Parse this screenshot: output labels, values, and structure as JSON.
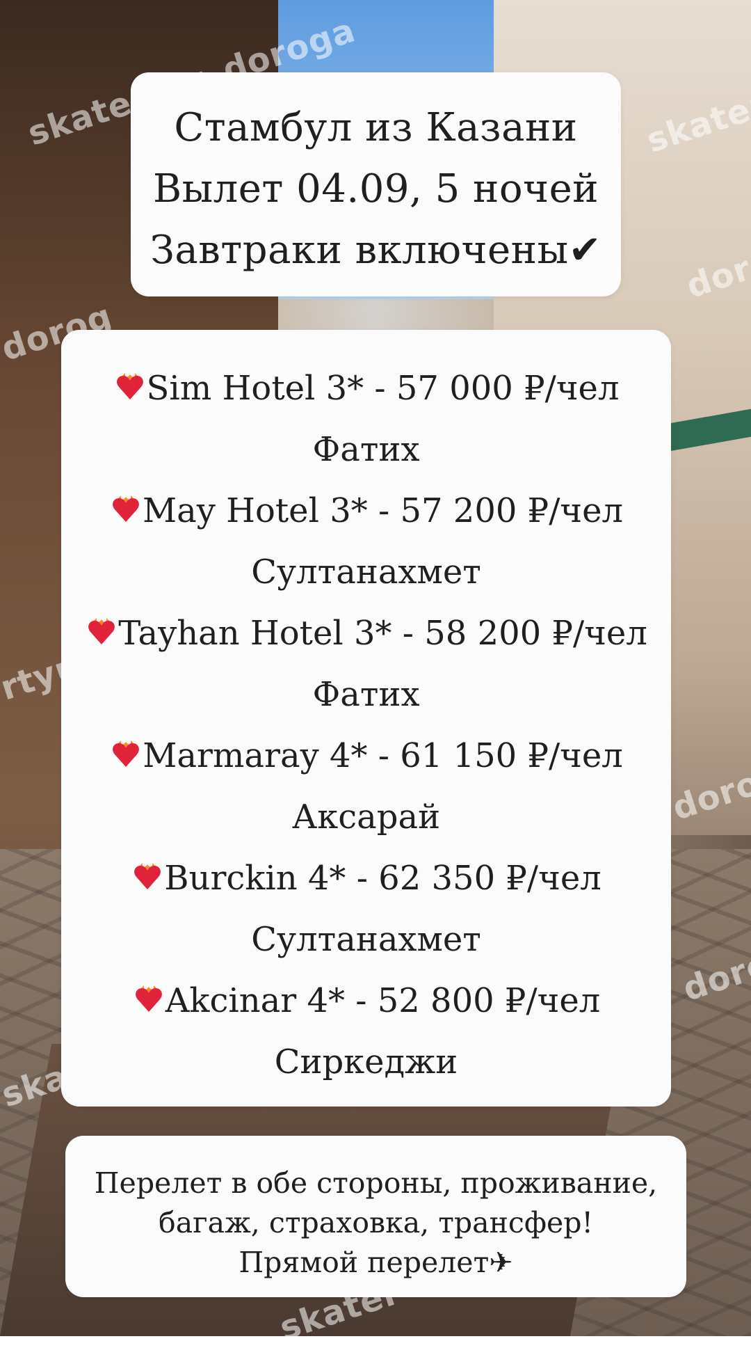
{
  "colors": {
    "card_bg": "#fbfbfb",
    "text": "#1f1f1f",
    "heart_fill": "#e0233b",
    "heart_flame": "#ff8a1a",
    "watermark": "rgba(255,255,255,0.55)"
  },
  "watermarks": [
    "skatertyu_doroga",
    "skatertyu_doroga",
    "dorog",
    "dorog",
    "rtyu",
    "dorog",
    "dorog",
    "skater",
    "skater"
  ],
  "title_card": {
    "line1": "Стамбул из Казани",
    "line2": "Вылет 04.09, 5 ночей",
    "line3": "Завтраки включены",
    "check_icon": "✔"
  },
  "hotels": [
    {
      "icon": "heart-on-fire-icon",
      "name": "Sim Hotel 3* - 57 000 ₽/чел",
      "district": "Фатих"
    },
    {
      "icon": "heart-on-fire-icon",
      "name": "May Hotel 3* - 57 200 ₽/чел",
      "district": "Султанахмет"
    },
    {
      "icon": "heart-on-fire-icon",
      "name": "Tayhan Hotel  3* - 58 200 ₽/чел",
      "district": "Фатих"
    },
    {
      "icon": "heart-on-fire-icon",
      "name": "Marmaray 4* - 61 150 ₽/чел",
      "district": "Аксарай"
    },
    {
      "icon": "heart-on-fire-icon",
      "name": "Burckin 4* - 62 350 ₽/чел",
      "district": "Султанахмет"
    },
    {
      "icon": "heart-on-fire-icon",
      "name": "Akcinar 4* - 52 800 ₽/чел",
      "district": "Сиркеджи"
    }
  ],
  "included_card": {
    "line1": "Перелет в обе стороны, проживание,",
    "line2": "багаж, страховка, трансфер!",
    "line3": "Прямой перелет",
    "plane_icon": "✈"
  }
}
